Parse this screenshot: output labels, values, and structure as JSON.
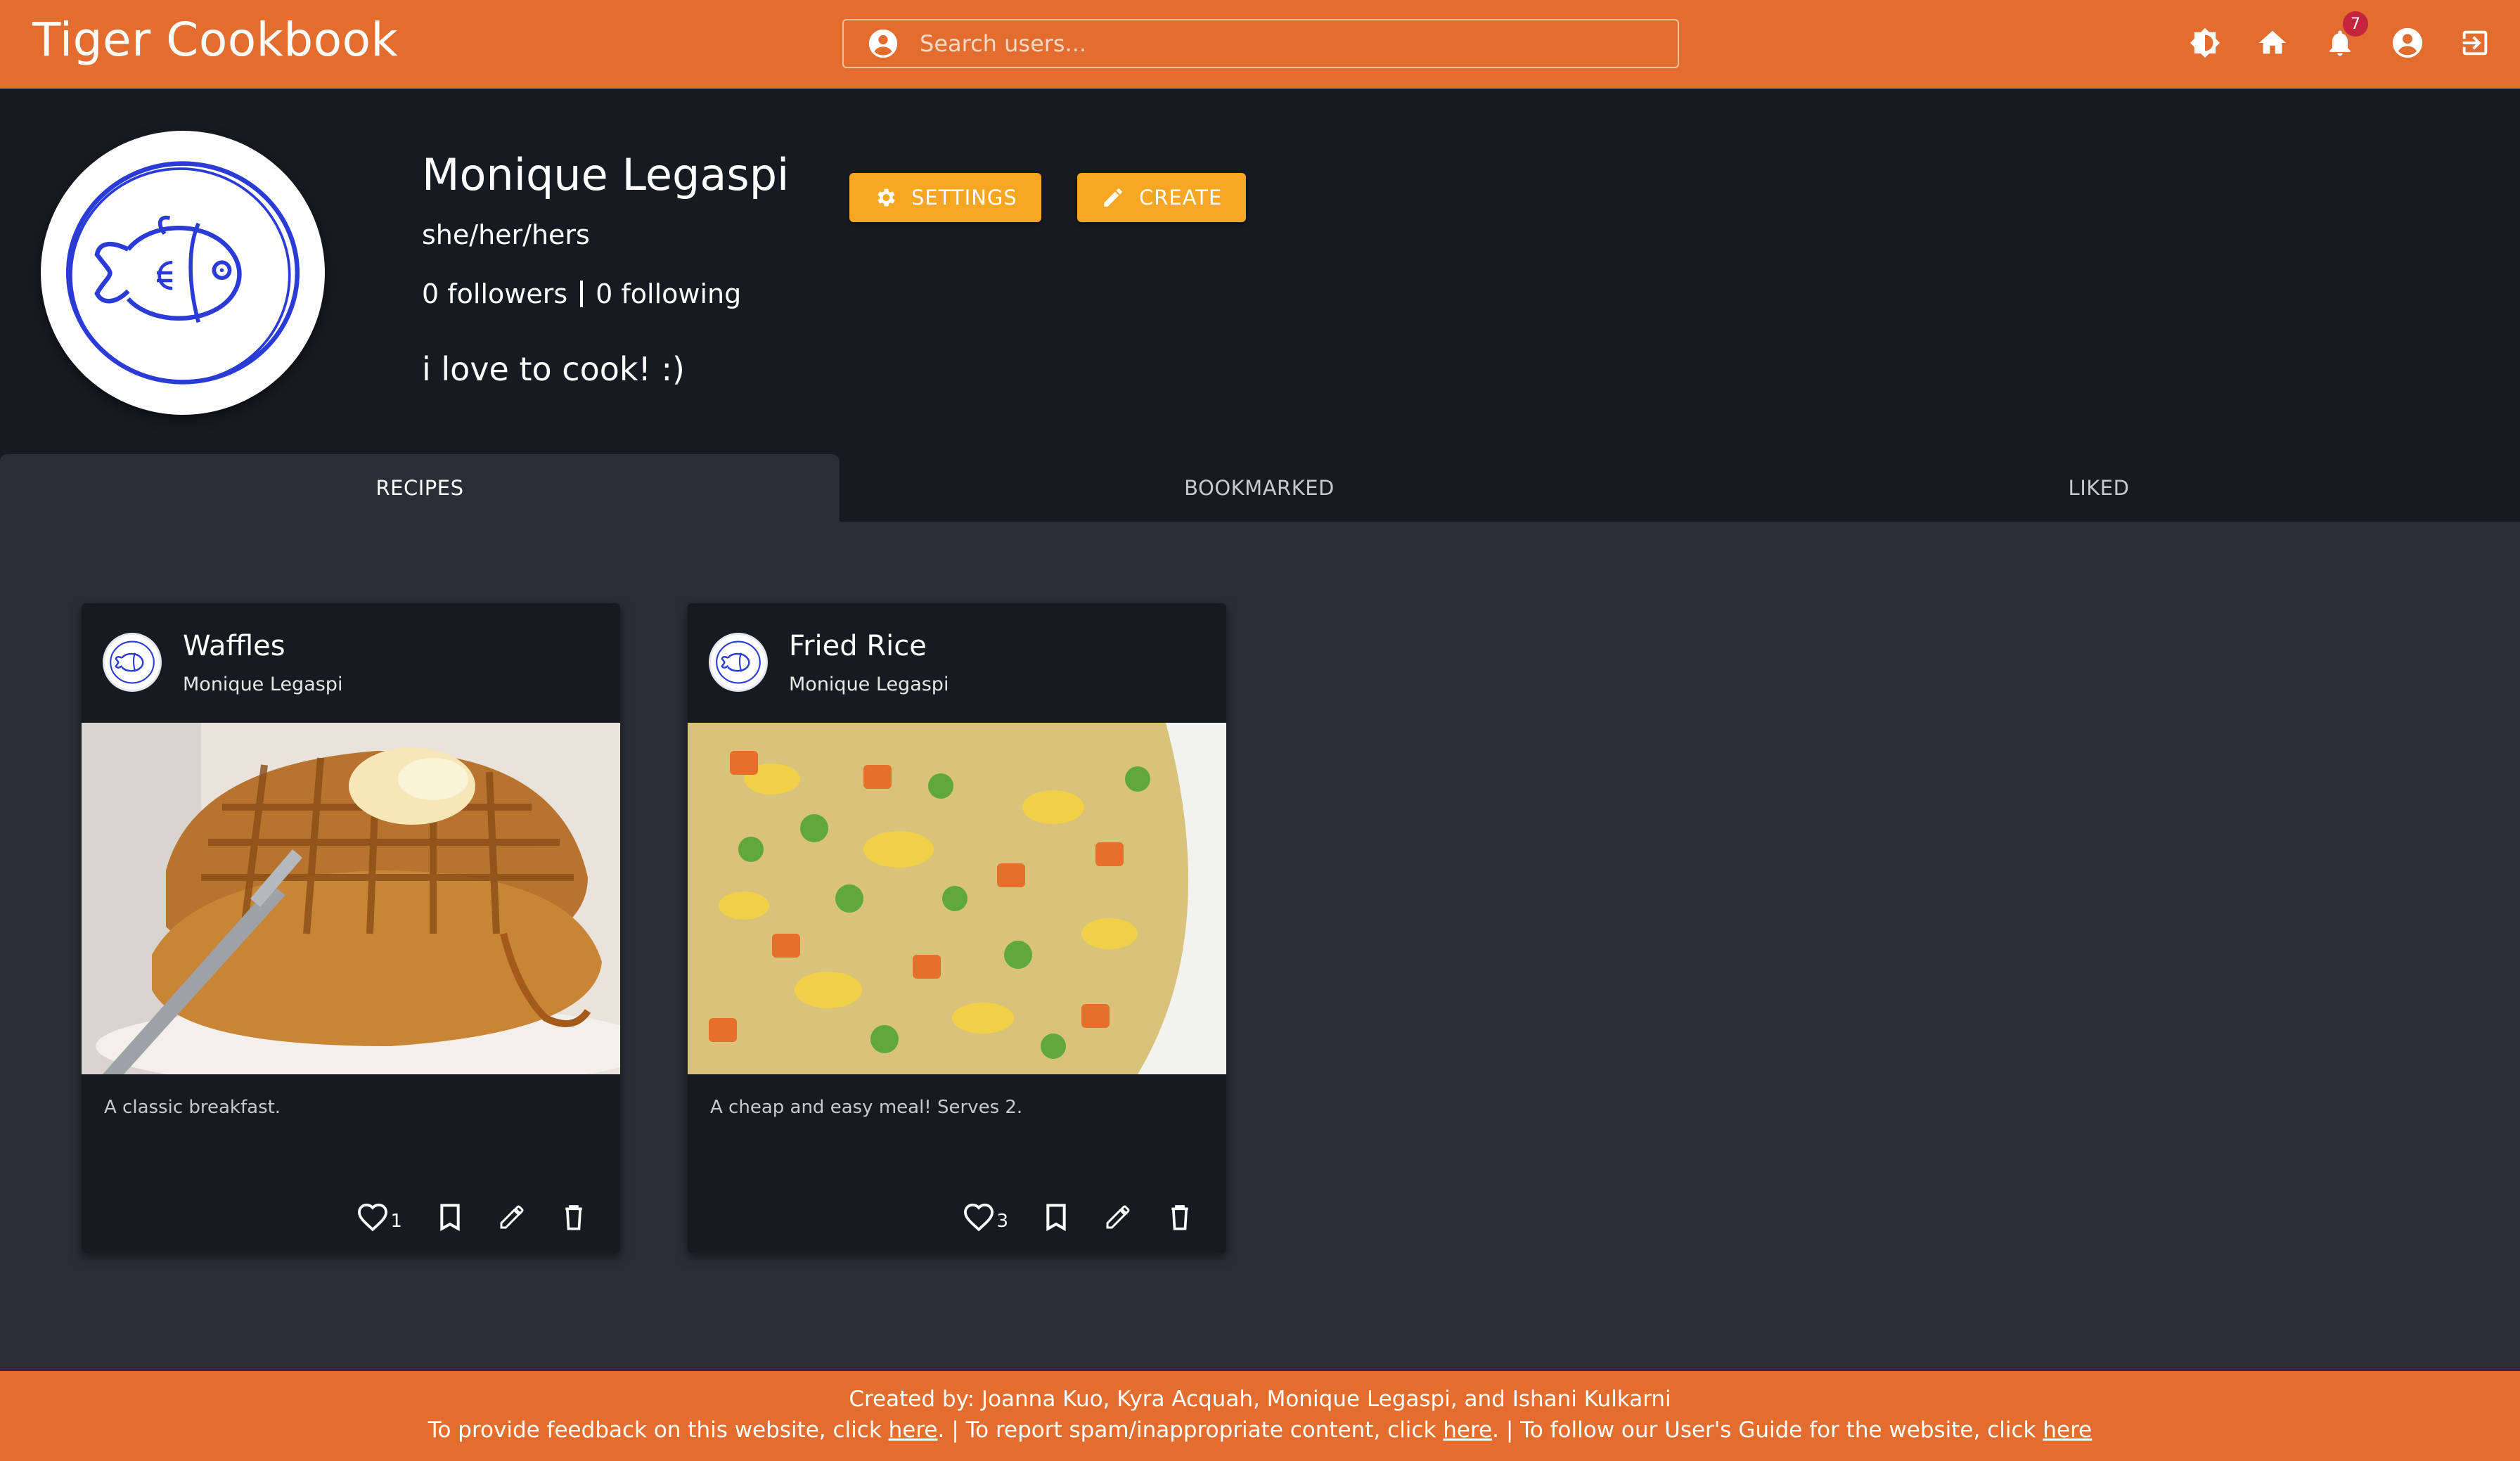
{
  "app": {
    "title": "Tiger Cookbook"
  },
  "search": {
    "placeholder": "Search users..."
  },
  "nav": {
    "notifications_count": "7",
    "icons": [
      "theme-toggle-icon",
      "home-icon",
      "bell-icon",
      "account-icon",
      "logout-icon"
    ]
  },
  "profile": {
    "name": "Monique Legaspi",
    "pronouns": "she/her/hers",
    "followers": "0 followers",
    "following": "0 following",
    "bio": "i love to cook! :)",
    "settings_label": "SETTINGS",
    "create_label": "CREATE"
  },
  "tabs": [
    {
      "label": "RECIPES",
      "active": true
    },
    {
      "label": "BOOKMARKED",
      "active": false
    },
    {
      "label": "LIKED",
      "active": false
    }
  ],
  "recipes": [
    {
      "title": "Waffles",
      "author": "Monique Legaspi",
      "description": "A classic breakfast.",
      "likes": "1"
    },
    {
      "title": "Fried Rice",
      "author": "Monique Legaspi",
      "description": "A cheap and easy meal! Serves 2.",
      "likes": "3"
    }
  ],
  "footer": {
    "line1": "Created by: Joanna Kuo, Kyra Acquah, Monique Legaspi, and Ishani Kulkarni",
    "feedback_text": "To provide feedback on this website, click ",
    "spam_text": ". | To report spam/inappropriate content, click ",
    "guide_text": ". | To follow our User's Guide for the website, click ",
    "link_label": "here",
    "period": "."
  },
  "colors": {
    "brand": "#e26d2e",
    "accent_button": "#f5a623",
    "header_bg": "#181a21",
    "page_bg": "#2a2d36",
    "badge": "#c6233f"
  }
}
